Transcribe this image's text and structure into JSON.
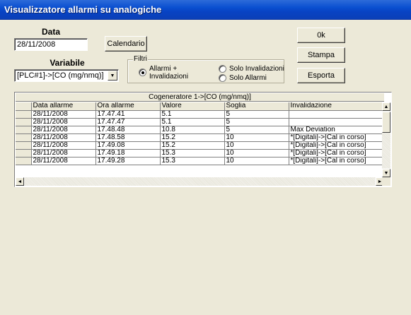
{
  "window": {
    "title": "Visualizzatore allarmi su analogiche"
  },
  "data_section": {
    "label": "Data",
    "value": "28/11/2008",
    "calendar_button": "Calendario"
  },
  "variable_section": {
    "label": "Variabile",
    "selected": "[PLC#1]->[CO (mg/nmq)]",
    "dropdown_arrow": "▼"
  },
  "filters": {
    "legend": "Filtri",
    "options": [
      {
        "label": "Allarmi + Invalidazioni",
        "line1": "Allarmi  +",
        "line2": "Invalidazioni",
        "selected": true
      },
      {
        "label": "Solo Invalidazioni",
        "selected": false
      },
      {
        "label": "Solo Allarmi",
        "selected": false
      }
    ]
  },
  "actions": {
    "ok": "0k",
    "print": "Stampa",
    "export": "Esporta"
  },
  "grid": {
    "title": "Cogeneratore 1->[CO (mg/nmq)]",
    "columns": [
      "Data allarme",
      "Ora allarme",
      "Valore",
      "Soglia",
      "Invalidazione"
    ],
    "rows": [
      [
        "28/11/2008",
        "17.47.41",
        "5.1",
        "5",
        ""
      ],
      [
        "28/11/2008",
        "17.47.47",
        "5.1",
        "5",
        ""
      ],
      [
        "28/11/2008",
        "17.48.48",
        "10.8",
        "5",
        "Max Deviation"
      ],
      [
        "28/11/2008",
        "17.48.58",
        "15.2",
        "10",
        "*[Digitali]->[Cal in corso]"
      ],
      [
        "28/11/2008",
        "17.49.08",
        "15.2",
        "10",
        "*[Digitali]->[Cal in corso]"
      ],
      [
        "28/11/2008",
        "17.49.18",
        "15.3",
        "10",
        "*[Digitali]->[Cal in corso]"
      ],
      [
        "28/11/2008",
        "17.49.28",
        "15.3",
        "10",
        "*[Digitali]->[Cal in corso]"
      ]
    ],
    "scroll_up": "▲",
    "scroll_down": "▼",
    "scroll_left": "◄",
    "scroll_right": "►"
  }
}
